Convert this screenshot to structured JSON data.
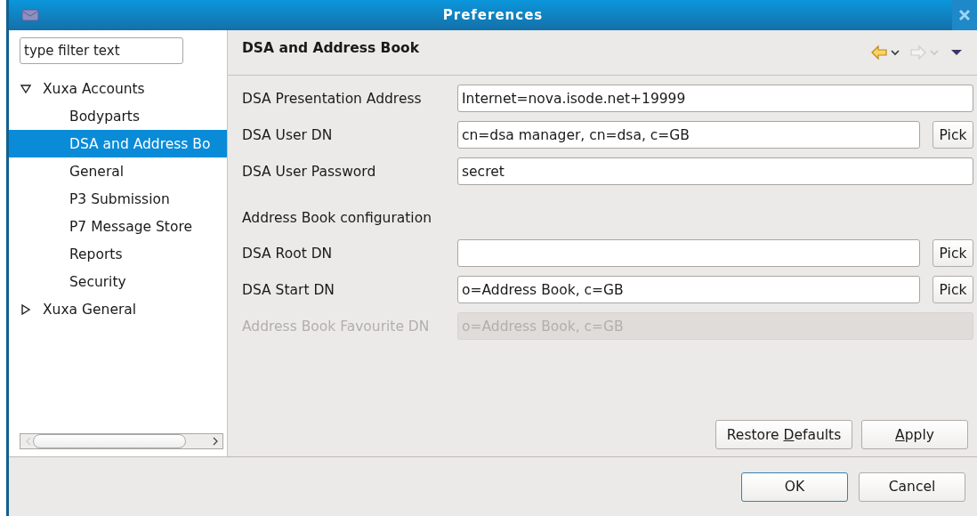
{
  "window": {
    "title": "Preferences"
  },
  "filter": {
    "placeholder": "type filter text"
  },
  "tree": [
    {
      "label": "Xuxa Accounts",
      "expanded": true,
      "selected": false,
      "children": [
        {
          "label": "Bodyparts",
          "selected": false
        },
        {
          "label": "DSA and Address Bo",
          "selected": true
        },
        {
          "label": "General",
          "selected": false
        },
        {
          "label": "P3 Submission",
          "selected": false
        },
        {
          "label": "P7 Message Store",
          "selected": false
        },
        {
          "label": "Reports",
          "selected": false
        },
        {
          "label": "Security",
          "selected": false
        }
      ]
    },
    {
      "label": "Xuxa General",
      "expanded": false,
      "selected": false
    }
  ],
  "page": {
    "title": "DSA and Address Book",
    "back_enabled": true,
    "forward_enabled": false
  },
  "form": [
    {
      "kind": "field",
      "label": "DSA Presentation Address",
      "value": "Internet=nova.isode.net+19999",
      "disabled": false
    },
    {
      "kind": "field",
      "label": "DSA User DN",
      "value": "cn=dsa manager, cn=dsa, c=GB",
      "disabled": false,
      "pick": "Pick"
    },
    {
      "kind": "field",
      "label": "DSA User Password",
      "value": "secret",
      "disabled": false
    },
    {
      "kind": "heading",
      "label": "Address Book configuration"
    },
    {
      "kind": "field",
      "label": "DSA Root DN",
      "disabled": false,
      "pick": "Pick"
    },
    {
      "kind": "field",
      "label": "DSA Start DN",
      "value": "o=Address Book, c=GB",
      "disabled": false,
      "pick": "Pick"
    },
    {
      "kind": "field",
      "label": "Address Book Favourite DN",
      "value": "o=Address Book, c=GB",
      "disabled": true
    }
  ],
  "page_buttons": [
    {
      "before": "Restore ",
      "key": "D",
      "after": "efaults"
    },
    {
      "key": "A",
      "after": "pply"
    }
  ],
  "dialog_buttons": [
    {
      "label": "OK",
      "default": true
    },
    {
      "label": "Cancel",
      "default": false
    }
  ]
}
